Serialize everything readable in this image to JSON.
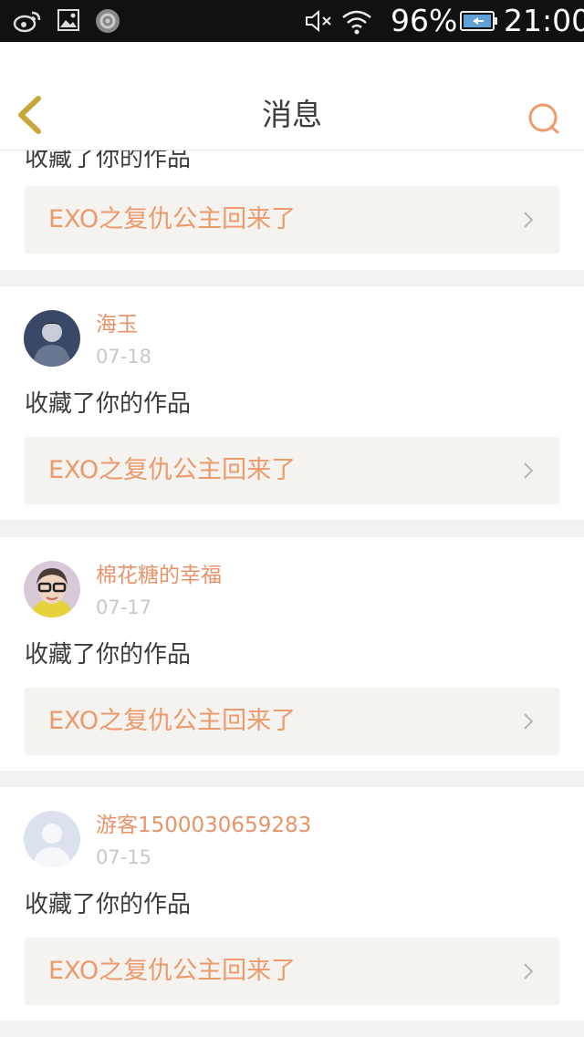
{
  "status_bar": {
    "battery_percent": "96%",
    "time": "21:00",
    "icons": [
      "weibo-icon",
      "gallery-icon",
      "app-icon",
      "mute-icon",
      "wifi-icon",
      "battery-icon"
    ]
  },
  "nav": {
    "title": "消息",
    "back_icon": "chevron-left-icon",
    "search_icon": "search-icon"
  },
  "accent_color": "#e8936a",
  "messages": [
    {
      "action": "收藏了你的作品",
      "work_title": "EXO之复仇公主回来了"
    },
    {
      "username": "海玉",
      "date": "07-18",
      "action": "收藏了你的作品",
      "work_title": "EXO之复仇公主回来了"
    },
    {
      "username": "棉花糖的幸福",
      "date": "07-17",
      "action": "收藏了你的作品",
      "work_title": "EXO之复仇公主回来了"
    },
    {
      "username": "游客1500030659283",
      "date": "07-15",
      "action": "收藏了你的作品",
      "work_title": "EXO之复仇公主回来了"
    }
  ]
}
